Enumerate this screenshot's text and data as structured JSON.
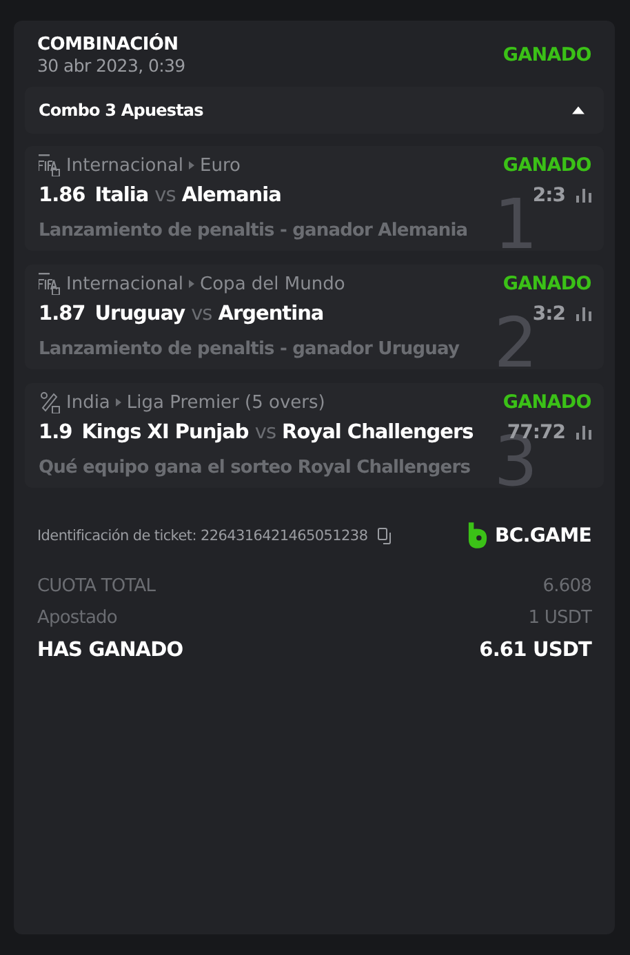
{
  "bet": {
    "type": "COMBINACIÓN",
    "date": "30 abr 2023, 0:39",
    "status": "GANADO"
  },
  "combo": {
    "label": "Combo 3 Apuestas",
    "expanded": true
  },
  "legs": [
    {
      "number": "1",
      "kind": "fifa",
      "country": "Internacional",
      "league": "Euro",
      "status": "GANADO",
      "odds": "1.86",
      "home": "Italia",
      "vs": "vs",
      "away": "Alemania",
      "score": "2:3",
      "market": "Lanzamiento de penaltis - ganador Alemania"
    },
    {
      "number": "2",
      "kind": "fifa",
      "country": "Internacional",
      "league": "Copa del Mundo",
      "status": "GANADO",
      "odds": "1.87",
      "home": "Uruguay",
      "vs": "vs",
      "away": "Argentina",
      "score": "3:2",
      "market": "Lanzamiento de penaltis - ganador Uruguay"
    },
    {
      "number": "3",
      "kind": "cricket",
      "country": "India",
      "league": "Liga Premier (5 overs)",
      "status": "GANADO",
      "odds": "1.9",
      "home": "Kings XI Punjab",
      "vs": "vs",
      "away": "Royal Challengers",
      "score": "77:72",
      "market": "Qué equipo gana el sorteo Royal Challengers"
    }
  ],
  "ticket": {
    "label": "Identificación de ticket: 2264316421465051238",
    "brand": "BC.GAME"
  },
  "summary": [
    {
      "kind": "muted",
      "label": "CUOTA TOTAL",
      "value": "6.608"
    },
    {
      "kind": "muted",
      "label": "Apostado",
      "value": "1 USDT"
    },
    {
      "kind": "total",
      "label": "HAS GANADO",
      "value": "6.61 USDT"
    }
  ]
}
